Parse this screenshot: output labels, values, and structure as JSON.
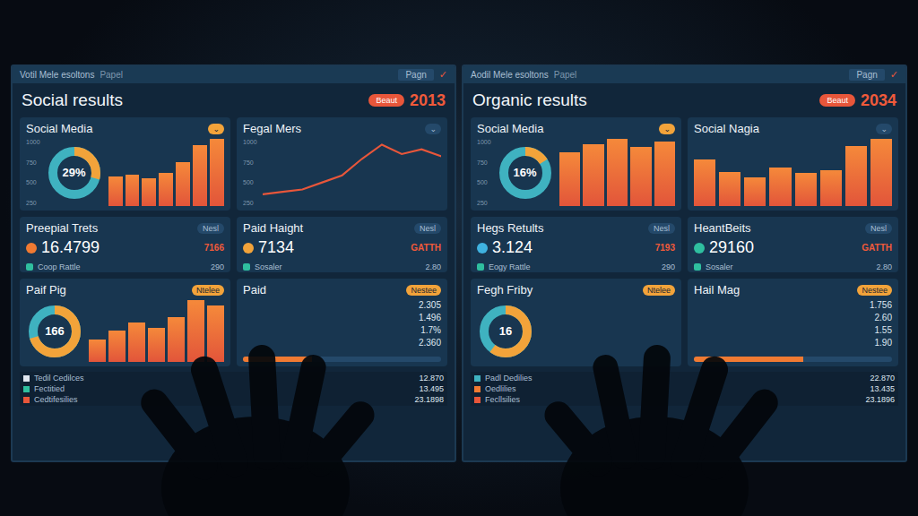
{
  "screens": [
    {
      "window_title": "Votil Mele esoltons",
      "tag": "Papel",
      "button": "Pagn",
      "check": "✓",
      "title": "Social results",
      "badge": "Beaut",
      "year": "2013",
      "cards": [
        {
          "kind": "donut-bars",
          "title": "Social Media",
          "caret": "⌄",
          "value": "29%",
          "level": 0.29,
          "values": [
            30,
            32,
            28,
            34,
            45,
            62,
            68
          ],
          "ticks": [
            "1000",
            "750",
            "500",
            "250"
          ]
        },
        {
          "kind": "line",
          "title": "Fegal Mers",
          "caret": "⌄",
          "values": [
            10,
            12,
            14,
            20,
            26,
            40,
            52,
            44,
            48,
            42
          ],
          "ticks": [
            "1000",
            "750",
            "500",
            "250"
          ]
        },
        {
          "kind": "stat",
          "title": "Preepial Trets",
          "pill": "Nesl",
          "icon_color": "#f07a32",
          "value": "16.4799",
          "delta": "7166",
          "sub": "Coop Rattle",
          "sub_value": "290"
        },
        {
          "kind": "stat",
          "title": "Paid Haight",
          "pill": "Nesl",
          "icon_color": "#f2a33a",
          "value": "7134",
          "delta": "GATTH",
          "sub": "Sosaler",
          "sub_value": "2.80"
        },
        {
          "kind": "donut-bars",
          "title": "Paif Pig",
          "caret": "Ntelee",
          "value": "166",
          "level": 0.7,
          "values": [
            20,
            28,
            35,
            30,
            40,
            55,
            50
          ],
          "ticks": []
        },
        {
          "kind": "list",
          "title": "Paid",
          "caret": "Nestee",
          "level": 0.35,
          "rows": [
            "2.305",
            "1.496",
            "1.7%",
            "2.360"
          ]
        }
      ],
      "legend": [
        {
          "label": "Tedil Cedilces",
          "color": "#e0e6ee",
          "value": "12.870"
        },
        {
          "label": "Fectitied",
          "color": "#2fbf9f",
          "value": "13.495"
        },
        {
          "label": "Cedtifesilies",
          "color": "#e8563a",
          "value": "23.1898"
        }
      ]
    },
    {
      "window_title": "Aodil Mele esoltons",
      "tag": "Papel",
      "button": "Pagn",
      "check": "✓",
      "title": "Organic results",
      "badge": "Beaut",
      "year": "2034",
      "cards": [
        {
          "kind": "donut-bars",
          "title": "Social Media",
          "caret": "⌄",
          "value": "16%",
          "level": 0.16,
          "values": [
            40,
            46,
            50,
            44,
            48
          ],
          "ticks": [
            "1000",
            "750",
            "500",
            "250"
          ]
        },
        {
          "kind": "bars",
          "title": "Social Nagia",
          "caret": "⌄",
          "values": [
            48,
            36,
            30,
            40,
            34,
            38,
            62,
            70
          ]
        },
        {
          "kind": "stat",
          "title": "Hegs Retults",
          "pill": "Nesl",
          "icon_color": "#3fb2e0",
          "value": "3.124",
          "delta": "7193",
          "sub": "Eogy Rattle",
          "sub_value": "290"
        },
        {
          "kind": "stat",
          "title": "HeantBeits",
          "pill": "Nesl",
          "icon_color": "#2fbf9f",
          "value": "29160",
          "delta": "GATTH",
          "sub": "Sosaler",
          "sub_value": "2.80"
        },
        {
          "kind": "donut-bars",
          "title": "Fegh Friby",
          "caret": "Ntelee",
          "value": "16",
          "level": 0.6,
          "values": [],
          "ticks": []
        },
        {
          "kind": "list",
          "title": "Hail Mag",
          "caret": "Nestee",
          "level": 0.55,
          "rows": [
            "1.756",
            "2.60",
            "1.55",
            "1.90"
          ]
        }
      ],
      "legend": [
        {
          "label": "Padl Dedilies",
          "color": "#3fb2c0",
          "value": "22.870"
        },
        {
          "label": "Oedlilies",
          "color": "#f07a32",
          "value": "13.435"
        },
        {
          "label": "Fecllsilies",
          "color": "#e8563a",
          "value": "23.1896"
        }
      ]
    }
  ]
}
